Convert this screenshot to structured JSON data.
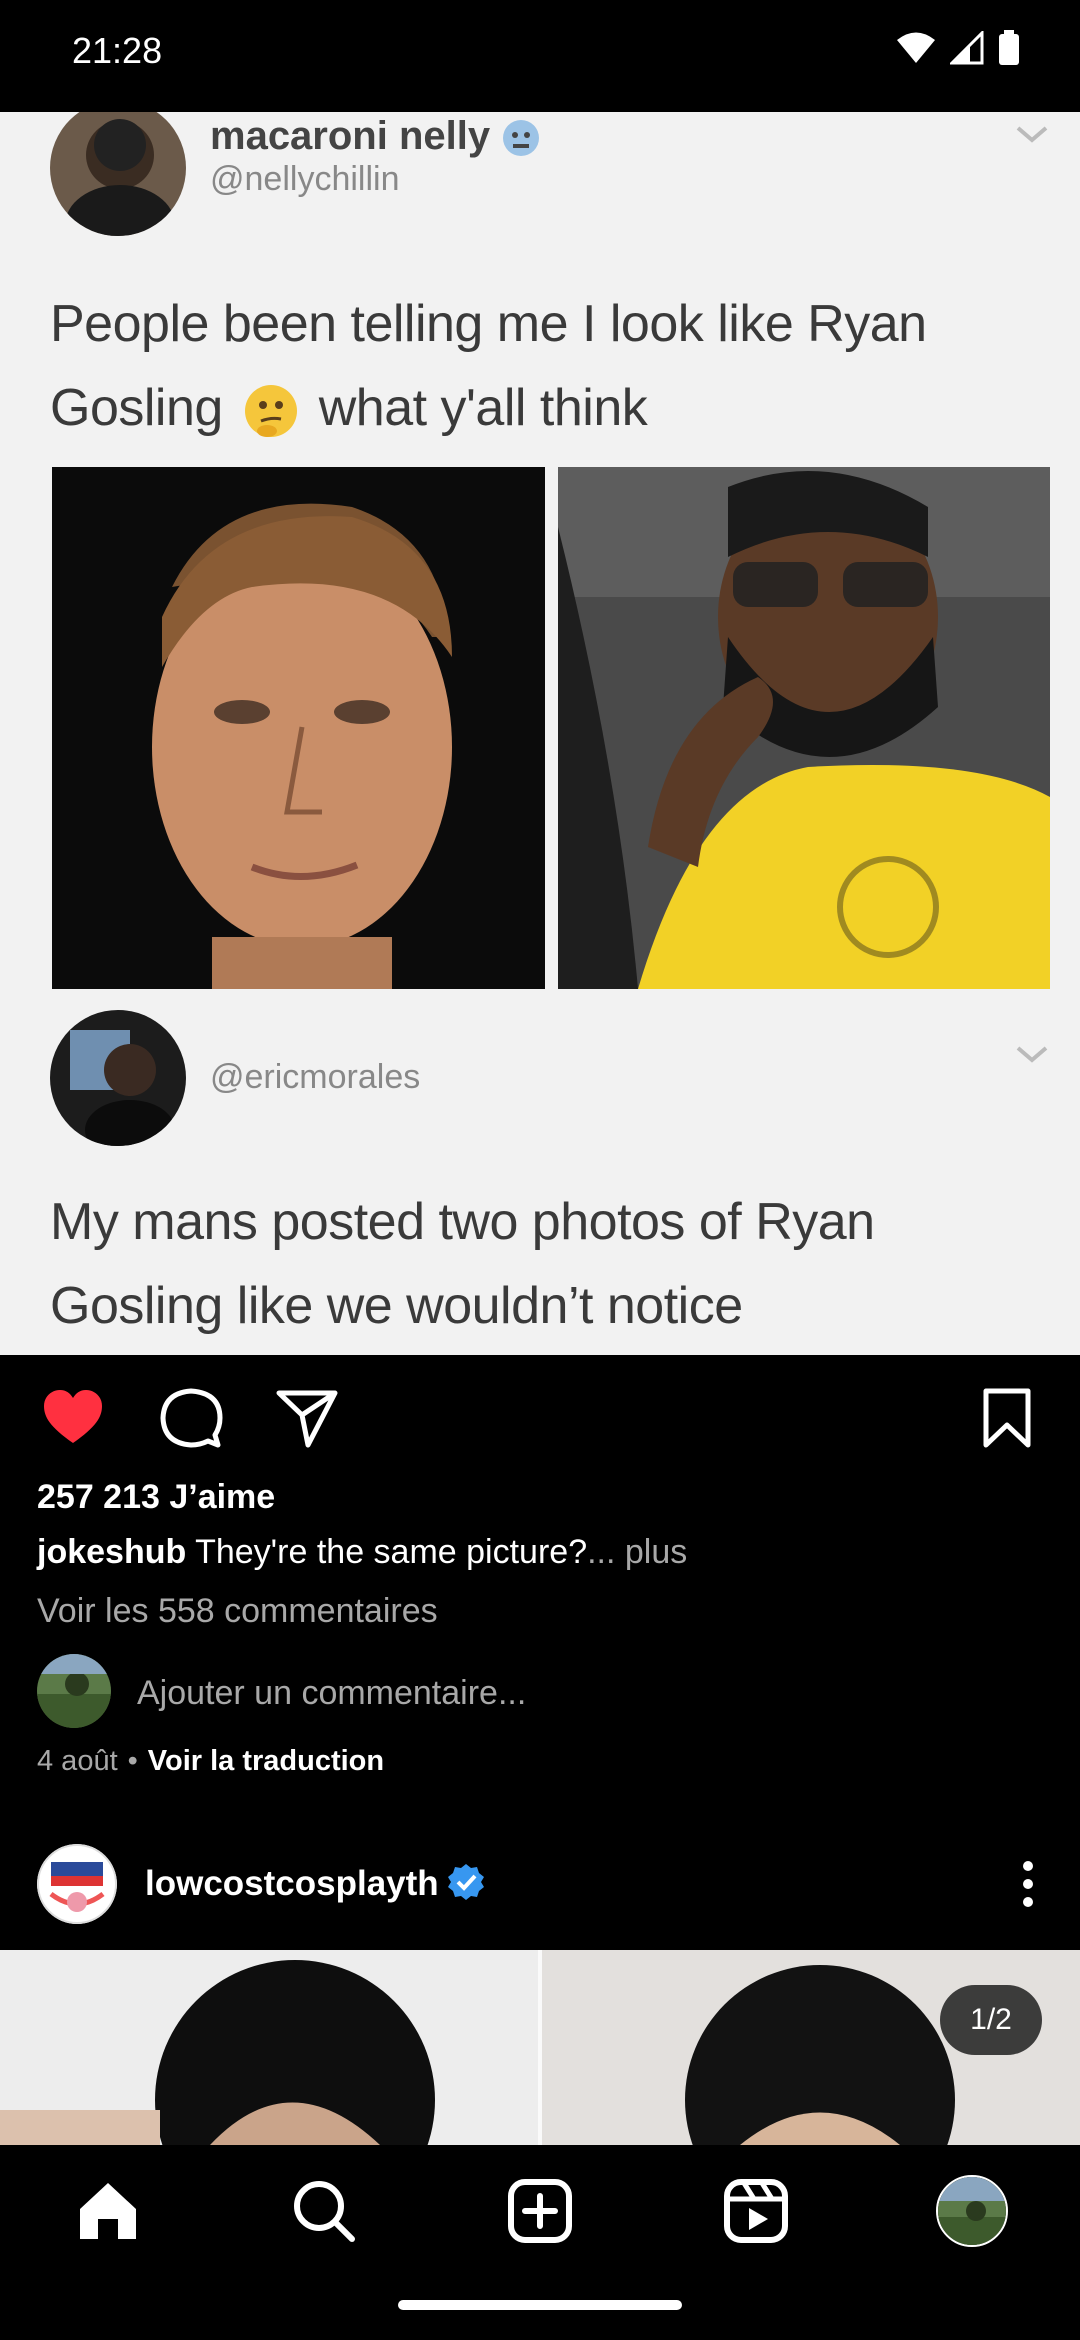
{
  "status_bar": {
    "time": "21:28"
  },
  "meme": {
    "tweet1": {
      "name": "macaroni nelly",
      "handle": "@nellychillin",
      "text_line1": "People been telling me I look like Ryan",
      "text_line2a": "Gosling",
      "text_line2b": "what y'all think"
    },
    "tweet2": {
      "handle": "@ericmorales",
      "text_line1": "My mans posted two photos of Ryan",
      "text_line2": "Gosling like we wouldn’t notice"
    }
  },
  "post": {
    "likes": "257 213 J’aime",
    "caption_user": "jokeshub",
    "caption_text": "They're the same picture?",
    "caption_more": "... plus",
    "view_comments": "Voir les 558 commentaires",
    "comment_placeholder": "Ajouter un commentaire...",
    "date": "4 août",
    "separator": "•",
    "translate": "Voir la traduction",
    "liked": true
  },
  "post2": {
    "username": "lowcostcosplayth",
    "verified": true,
    "page_indicator": "1/2"
  },
  "icons": {
    "like": "heart-filled-icon",
    "comment": "comment-bubble-icon",
    "share": "paper-plane-icon",
    "save": "bookmark-icon",
    "home": "home-icon",
    "search": "search-icon",
    "create": "plus-square-icon",
    "reels": "reels-icon",
    "profile": "profile-avatar"
  },
  "colors": {
    "like_red": "#ff3040",
    "verified_blue": "#3797f0",
    "background": "#000000"
  }
}
